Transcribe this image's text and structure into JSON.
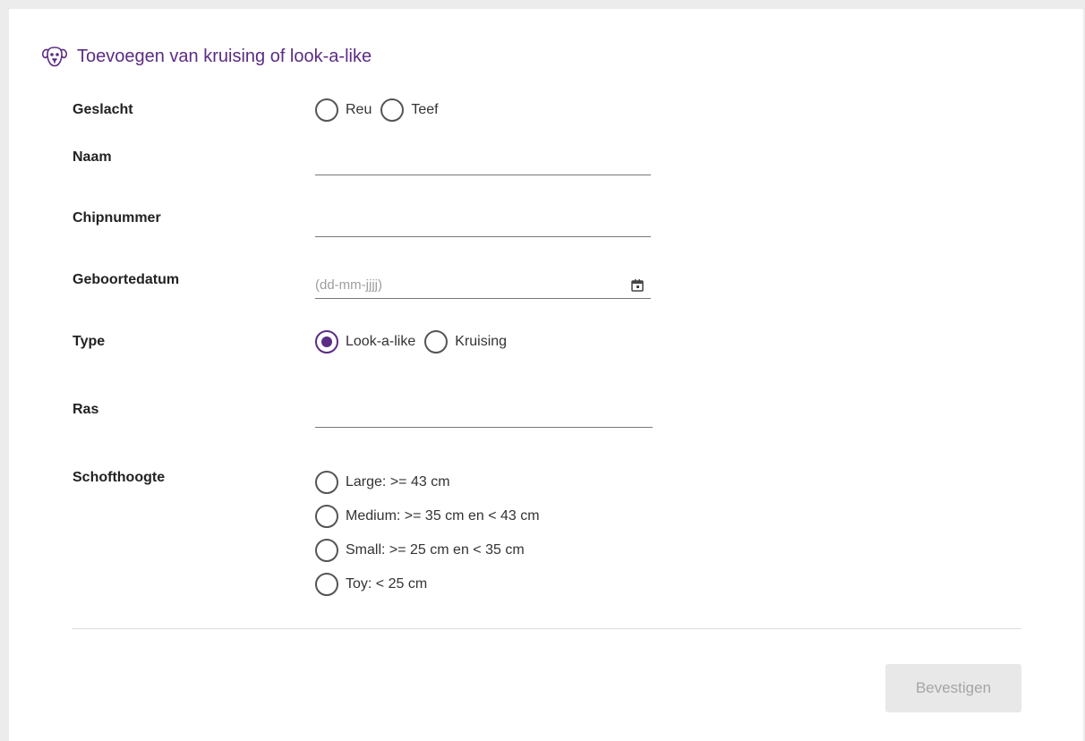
{
  "header": {
    "icon": "dog-head-icon",
    "title": "Toevoegen van kruising of look-a-like"
  },
  "form": {
    "gender": {
      "label": "Geslacht",
      "options": [
        "Reu",
        "Teef"
      ],
      "selected": null
    },
    "name": {
      "label": "Naam",
      "value": ""
    },
    "chip": {
      "label": "Chipnummer",
      "value": ""
    },
    "birthdate": {
      "label": "Geboortedatum",
      "placeholder": "(dd-mm-jjjj)",
      "icon": "calendar-icon"
    },
    "type": {
      "label": "Type",
      "options": [
        "Look-a-like",
        "Kruising"
      ],
      "selected": "Look-a-like"
    },
    "breed": {
      "label": "Ras",
      "value": ""
    },
    "size": {
      "label": "Schofthoogte",
      "options": [
        "Large: >= 43 cm",
        "Medium: >= 35 cm en < 43 cm",
        "Small: >= 25 cm en < 35 cm",
        "Toy: < 25 cm"
      ],
      "selected": null
    }
  },
  "footer": {
    "confirm_label": "Bevestigen",
    "confirm_enabled": false
  },
  "colors": {
    "accent": "#5b2c83",
    "disabled_bg": "#e8e8e8",
    "disabled_text": "#a5a5a5"
  }
}
